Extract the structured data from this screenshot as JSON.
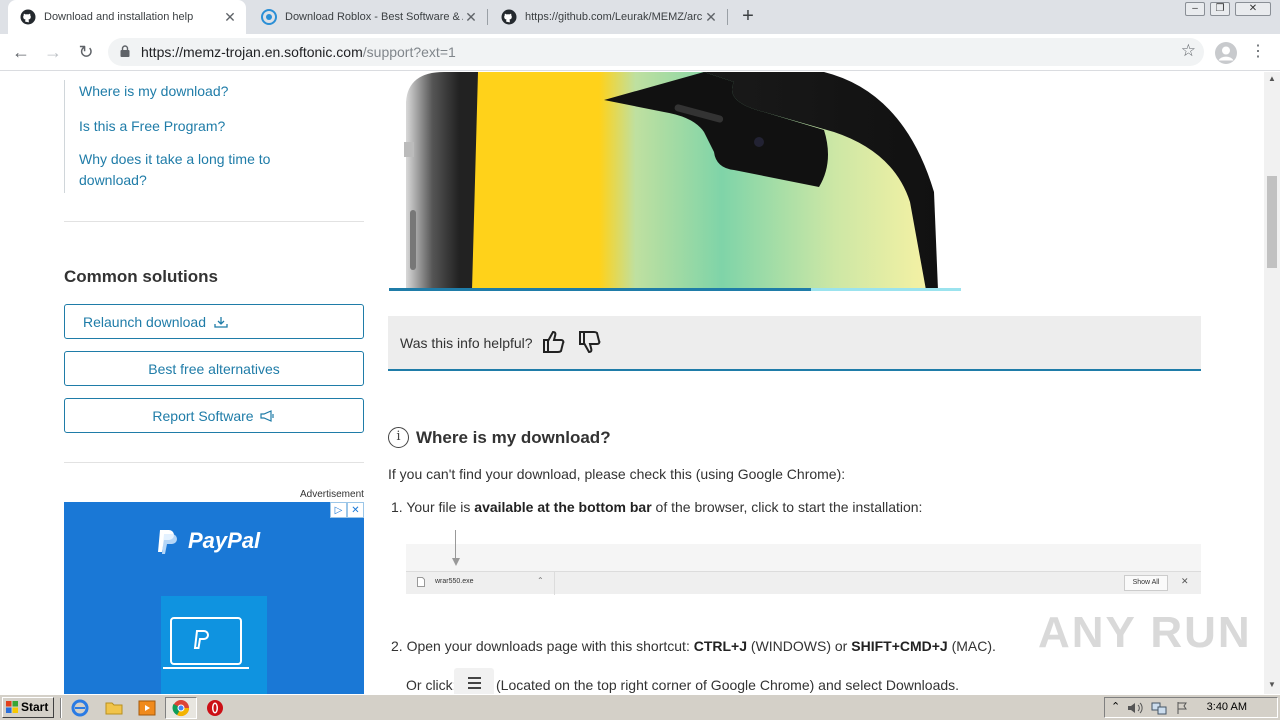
{
  "browser": {
    "tabs": [
      {
        "title": "Download and installation help",
        "active": true
      },
      {
        "title": "Download Roblox - Best Software & Apps",
        "active": false
      },
      {
        "title": "https://github.com/Leurak/MEMZ/archive",
        "active": false
      }
    ],
    "url_host": "https://memz-trojan.en.softonic.com",
    "url_path": "/support?ext=1"
  },
  "sidebar": {
    "links": [
      "Where is my download?",
      "Is this a Free Program?",
      "Why does it take a long time to",
      "download?"
    ],
    "common_title": "Common solutions",
    "buttons": {
      "relaunch": "Relaunch download",
      "alternatives": "Best free alternatives",
      "report": "Report Software"
    },
    "ad_label": "Advertisement",
    "ad_brand": "PayPal"
  },
  "content": {
    "feedback_question": "Was this info helpful?",
    "section_title": "Where is my download?",
    "intro": "If you can't find your download, please check this (using Google Chrome):",
    "step1_prefix": "1. Your file is ",
    "step1_bold": "available at the bottom bar",
    "step1_suffix": " of the browser, click to start the installation:",
    "dlbar": {
      "file": "wrar550.exe",
      "show_all": "Show All",
      "close": "✕",
      "caret": "⌃"
    },
    "step2_prefix": "2. Open your downloads page with this shortcut: ",
    "step2_k1": "CTRL+J",
    "step2_mid": " (WINDOWS) or ",
    "step2_k2": "SHIFT+CMD+J",
    "step2_suffix": " (MAC).",
    "orclick_prefix": "Or click:",
    "orclick_suffix": "(Located on the top right corner of Google Chrome) and select Downloads."
  },
  "watermark": "ANY RUN",
  "taskbar": {
    "start": "Start",
    "clock": "3:40 AM"
  },
  "colors": {
    "link": "#1f7ca8",
    "ad_bg": "#1a78d6"
  }
}
